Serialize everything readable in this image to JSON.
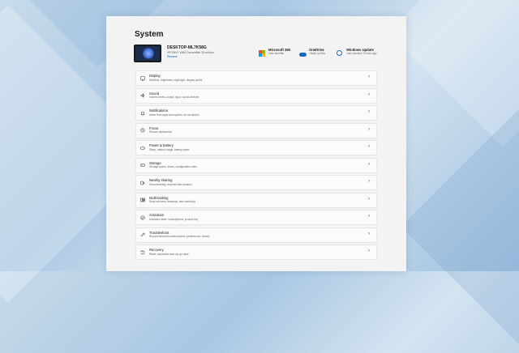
{
  "window": {
    "title": "System"
  },
  "device": {
    "name": "DESKTOP-ML7K58G",
    "model": "HP ENVY x360 Convertible 15-eu0xxx",
    "rename_label": "Rename"
  },
  "tiles": [
    {
      "title": "Microsoft 365",
      "subtitle": "View benefits",
      "icon": "microsoft-logo-icon"
    },
    {
      "title": "OneDrive",
      "subtitle": "• Back up files",
      "icon": "cloud-icon"
    },
    {
      "title": "Windows Update",
      "subtitle": "Last checked: 3 hours ago",
      "icon": "update-icon"
    }
  ],
  "settings": [
    {
      "title": "Display",
      "subtitle": "Monitors, brightness, night light, display profile",
      "icon": "monitor-icon"
    },
    {
      "title": "Sound",
      "subtitle": "Volume levels, output, input, sound devices",
      "icon": "speaker-icon"
    },
    {
      "title": "Notifications",
      "subtitle": "Alerts from apps and system, do not disturb",
      "icon": "bell-icon"
    },
    {
      "title": "Focus",
      "subtitle": "Reduce distractions",
      "icon": "focus-icon"
    },
    {
      "title": "Power & battery",
      "subtitle": "Sleep, battery usage, battery saver",
      "icon": "power-icon"
    },
    {
      "title": "Storage",
      "subtitle": "Storage space, drives, configuration rules",
      "icon": "storage-icon"
    },
    {
      "title": "Nearby sharing",
      "subtitle": "Discoverability, received files location",
      "icon": "share-icon"
    },
    {
      "title": "Multi-tasking",
      "subtitle": "Snap windows, desktops, task switching",
      "icon": "multitask-icon"
    },
    {
      "title": "Activation",
      "subtitle": "Activation state, subscriptions, product key",
      "icon": "activation-icon"
    },
    {
      "title": "Troubleshoot",
      "subtitle": "Recommended troubleshooters, preferences, history",
      "icon": "wrench-icon"
    },
    {
      "title": "Recovery",
      "subtitle": "Reset, advanced start-up, go back",
      "icon": "recovery-icon"
    }
  ],
  "chevron": "›",
  "colors": {
    "accent": "#0067c0",
    "ms_red": "#f25022",
    "ms_green": "#7fba00",
    "ms_blue": "#00a4ef",
    "ms_yellow": "#ffb900"
  }
}
